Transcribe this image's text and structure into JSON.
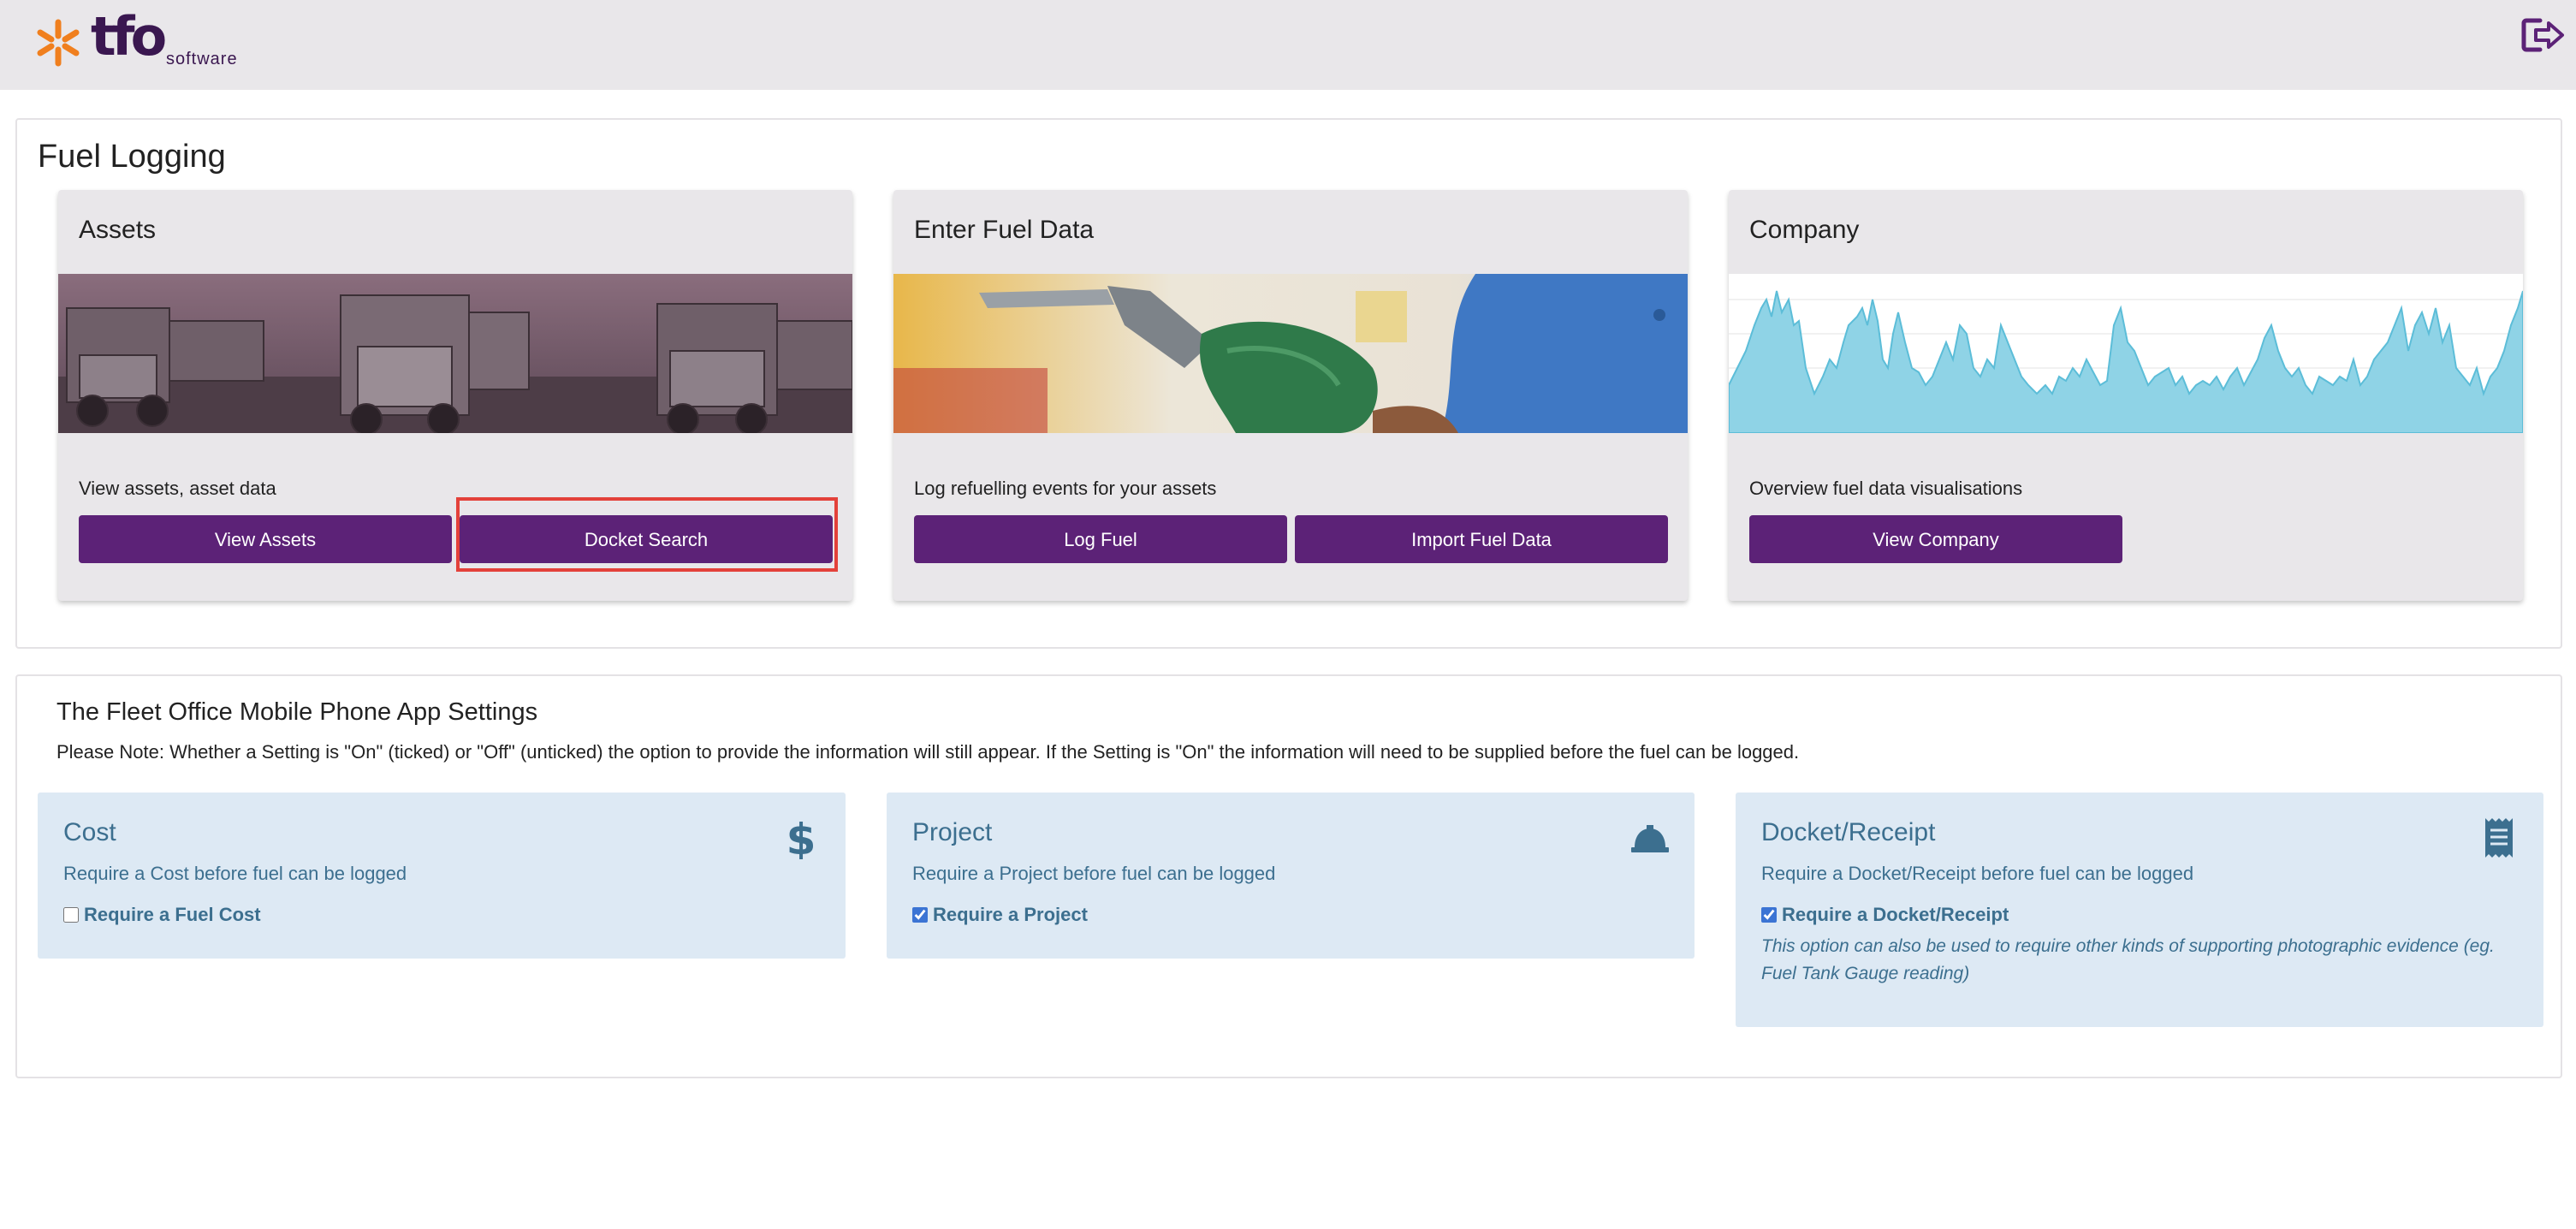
{
  "header": {
    "logo_text": "tfo",
    "logo_subtext": "software",
    "logout_icon": "logout-icon"
  },
  "fuel_logging": {
    "title": "Fuel Logging",
    "cards": [
      {
        "title": "Assets",
        "image": "trucks-photo",
        "description": "View assets, asset data",
        "buttons": [
          "View Assets",
          "Docket Search"
        ]
      },
      {
        "title": "Enter Fuel Data",
        "image": "fuel-nozzle-photo",
        "description": "Log refuelling events for your assets",
        "buttons": [
          "Log Fuel",
          "Import Fuel Data"
        ]
      },
      {
        "title": "Company",
        "image": "fuel-usage-area-chart",
        "description": "Overview fuel data visualisations",
        "buttons": [
          "View Company"
        ]
      }
    ]
  },
  "app_settings": {
    "title": "The Fleet Office Mobile Phone App Settings",
    "note": "Please Note: Whether a Setting is \"On\" (ticked) or \"Off\" (unticked) the option to provide the information will still appear. If the Setting is \"On\" the information will need to be supplied before the fuel can be logged.",
    "settings": [
      {
        "title": "Cost",
        "icon": "dollar-icon",
        "description": "Require a Cost before fuel can be logged",
        "checkbox_label": "Require a Fuel Cost",
        "checked": false
      },
      {
        "title": "Project",
        "icon": "hard-hat-icon",
        "description": "Require a Project before fuel can be logged",
        "checkbox_label": "Require a Project",
        "checked": true
      },
      {
        "title": "Docket/Receipt",
        "icon": "receipt-icon",
        "description": "Require a Docket/Receipt before fuel can be logged",
        "checkbox_label": "Require a Docket/Receipt",
        "checked": true,
        "extra": "This option can also be used to require other kinds of supporting photographic evidence (eg. Fuel Tank Gauge reading)"
      }
    ]
  },
  "colors": {
    "topbar": "#e9e7ea",
    "brand_purple": "#5c2277",
    "logo_orange": "#f07f1e",
    "highlight_red": "#e3413a",
    "setting_bg": "#dde9f4",
    "setting_text": "#3c6f8f",
    "chart_fill": "#8fd3e6"
  }
}
